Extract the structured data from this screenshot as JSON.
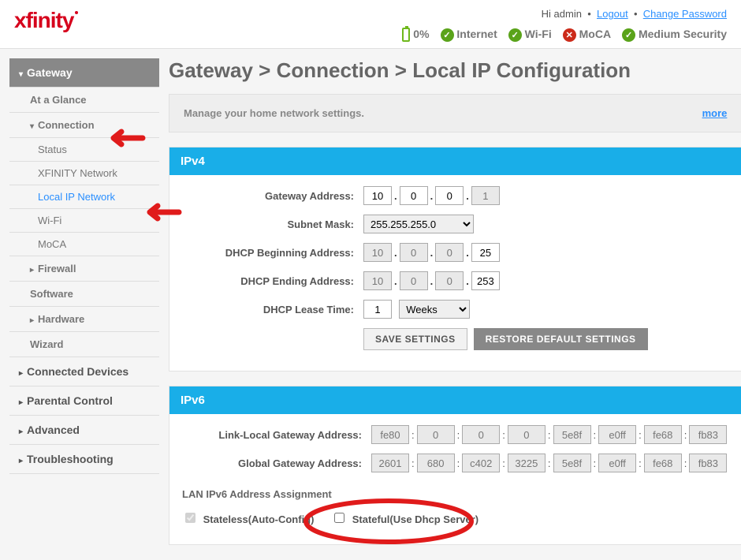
{
  "top": {
    "logo": "xfinity",
    "greeting": "Hi admin",
    "logout": "Logout",
    "change_pw": "Change Password",
    "battery_pct": "0%",
    "status": [
      {
        "name": "Internet",
        "ok": true
      },
      {
        "name": "Wi-Fi",
        "ok": true
      },
      {
        "name": "MoCA",
        "ok": false
      },
      {
        "name": "Medium Security",
        "ok": true
      }
    ]
  },
  "sidebar": {
    "gateway": "Gateway",
    "at_a_glance": "At a Glance",
    "connection": "Connection",
    "status": "Status",
    "xfinity_network": "XFINITY Network",
    "local_ip": "Local IP Network",
    "wifi": "Wi-Fi",
    "moca": "MoCA",
    "firewall": "Firewall",
    "software": "Software",
    "hardware": "Hardware",
    "wizard": "Wizard",
    "connected_devices": "Connected Devices",
    "parental": "Parental Control",
    "advanced": "Advanced",
    "troubleshooting": "Troubleshooting"
  },
  "page": {
    "title": "Gateway > Connection > Local IP Configuration",
    "subtitle": "Manage your home network settings.",
    "more": "more"
  },
  "ipv4": {
    "heading": "IPv4",
    "labels": {
      "gateway": "Gateway Address:",
      "subnet": "Subnet Mask:",
      "dhcp_begin": "DHCP Beginning Address:",
      "dhcp_end": "DHCP Ending Address:",
      "lease": "DHCP Lease Time:"
    },
    "gateway": [
      "10",
      "0",
      "0",
      "1"
    ],
    "subnet_selected": "255.255.255.0",
    "dhcp_begin": [
      "10",
      "0",
      "0",
      "25"
    ],
    "dhcp_end": [
      "10",
      "0",
      "0",
      "253"
    ],
    "lease_value": "1",
    "lease_unit": "Weeks",
    "save": "SAVE SETTINGS",
    "restore": "RESTORE DEFAULT SETTINGS"
  },
  "ipv6": {
    "heading": "IPv6",
    "labels": {
      "link_local": "Link-Local Gateway Address:",
      "global": "Global Gateway Address:",
      "assign": "LAN IPv6 Address Assignment"
    },
    "link_local": [
      "fe80",
      "0",
      "0",
      "0",
      "5e8f",
      "e0ff",
      "fe68",
      "fb83"
    ],
    "global": [
      "2601",
      "680",
      "c402",
      "3225",
      "5e8f",
      "e0ff",
      "fe68",
      "fb83"
    ],
    "stateless": "Stateless(Auto-Config)",
    "stateful": "Stateful(Use Dhcp Server)"
  }
}
